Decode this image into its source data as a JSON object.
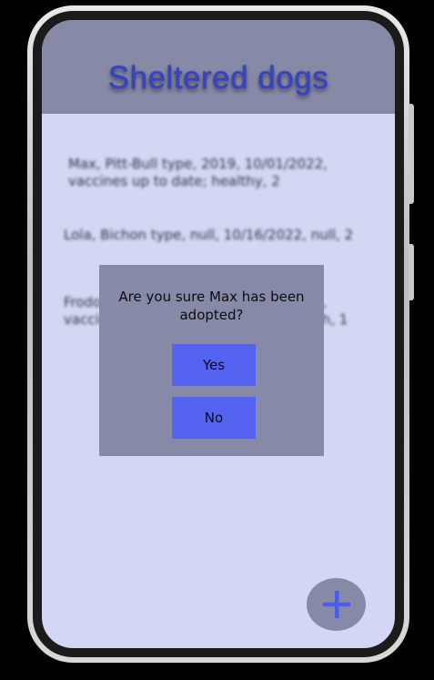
{
  "app": {
    "title": "Sheltered dogs"
  },
  "dogs": [
    {
      "text": "Max, Pitt-Bull type, 2019, 10/01/2022, vaccines up to date; healthy, 2"
    },
    {
      "text": "Lola, Bichon type, null, 10/16/2022, null, 2"
    },
    {
      "text": "Frodo, Beagle type, 2020, 10/07/2022, vaccines up to date; sensitive stomach, 1"
    }
  ],
  "dialog": {
    "message": "Are you sure Max has been adopted?",
    "yes_label": "Yes",
    "no_label": "No"
  },
  "fab": {
    "icon": "plus-icon"
  },
  "colors": {
    "header": "#878aa7",
    "screen_bg": "#d4d7f3",
    "title": "#3443c8",
    "button": "#5563f1",
    "fab_plus": "#4d5bee"
  }
}
